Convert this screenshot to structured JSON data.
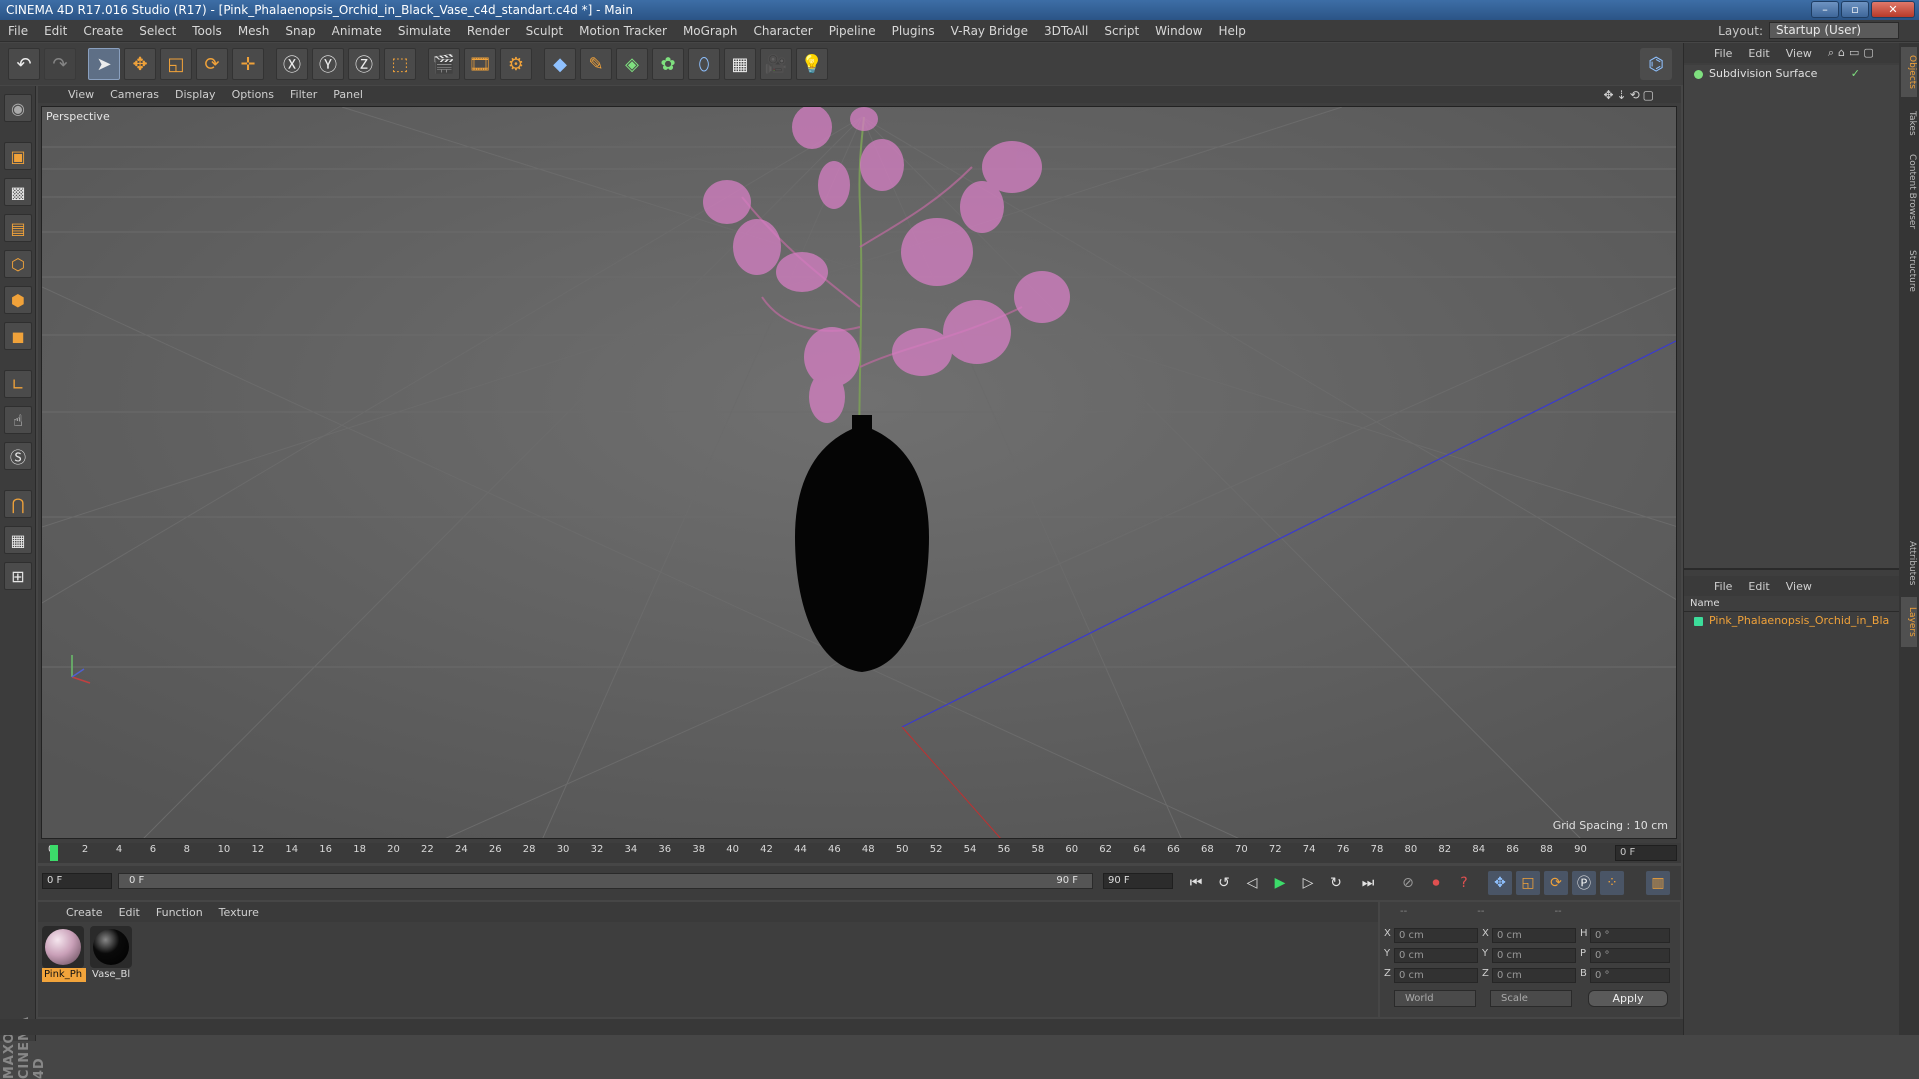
{
  "window": {
    "title": "CINEMA 4D R17.016 Studio (R17) - [Pink_Phalaenopsis_Orchid_in_Black_Vase_c4d_standart.c4d *] - Main"
  },
  "menubar": {
    "items": [
      "File",
      "Edit",
      "Create",
      "Select",
      "Tools",
      "Mesh",
      "Snap",
      "Animate",
      "Simulate",
      "Render",
      "Sculpt",
      "Motion Tracker",
      "MoGraph",
      "Character",
      "Pipeline",
      "Plugins",
      "V-Ray Bridge",
      "3DToAll",
      "Script",
      "Window",
      "Help"
    ],
    "layout_label": "Layout:",
    "layout_value": "Startup (User)"
  },
  "viewport": {
    "menu": [
      "View",
      "Cameras",
      "Display",
      "Options",
      "Filter",
      "Panel"
    ],
    "camera_label": "Perspective",
    "grid_spacing": "Grid Spacing : 10 cm"
  },
  "timeline": {
    "ticks": [
      "0",
      "2",
      "4",
      "6",
      "8",
      "10",
      "12",
      "14",
      "16",
      "18",
      "20",
      "22",
      "24",
      "26",
      "28",
      "30",
      "32",
      "34",
      "36",
      "38",
      "40",
      "42",
      "44",
      "46",
      "48",
      "50",
      "52",
      "54",
      "56",
      "58",
      "60",
      "62",
      "64",
      "66",
      "68",
      "70",
      "72",
      "74",
      "76",
      "78",
      "80",
      "82",
      "84",
      "86",
      "88",
      "90"
    ],
    "current_frame": "0 F",
    "start_field": "0 F",
    "slider_start": "0 F",
    "slider_end": "90 F",
    "end_field": "90 F"
  },
  "materials": {
    "menu": [
      "Create",
      "Edit",
      "Function",
      "Texture"
    ],
    "items": [
      {
        "label": "Pink_Ph",
        "color": "#c9a0b8"
      },
      {
        "label": "Vase_Bl",
        "color": "#0a0a0a"
      }
    ]
  },
  "coordinates": {
    "header": [
      "--",
      "--",
      "--"
    ],
    "rows": [
      {
        "a": "X",
        "av": "0 cm",
        "b": "X",
        "bv": "0 cm",
        "c": "H",
        "cv": "0 °"
      },
      {
        "a": "Y",
        "av": "0 cm",
        "b": "Y",
        "bv": "0 cm",
        "c": "P",
        "cv": "0 °"
      },
      {
        "a": "Z",
        "av": "0 cm",
        "b": "Z",
        "bv": "0 cm",
        "c": "B",
        "cv": "0 °"
      }
    ],
    "world": "World",
    "scale": "Scale",
    "apply": "Apply"
  },
  "objects": {
    "menu": [
      "File",
      "Edit",
      "View"
    ],
    "items": [
      {
        "name": "Subdivision Surface"
      }
    ]
  },
  "layers": {
    "menu": [
      "File",
      "Edit",
      "View"
    ],
    "column": "Name",
    "items": [
      {
        "name": "Pink_Phalaenopsis_Orchid_in_Bla"
      }
    ]
  },
  "side_tabs": [
    "Objects",
    "Takes",
    "Content Browser",
    "Structure",
    "Attributes",
    "Layers"
  ],
  "brand": "MAXON CINEMA 4D"
}
